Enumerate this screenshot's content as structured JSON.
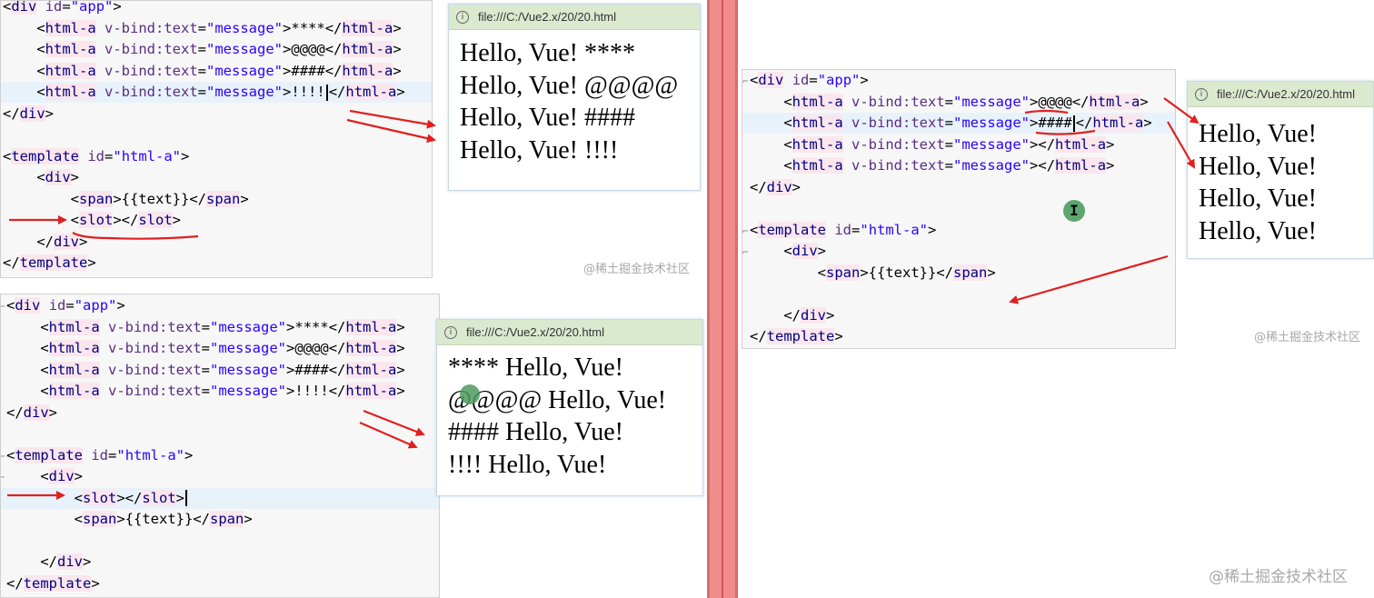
{
  "top_left": {
    "code": [
      {
        "kind": "open",
        "tag": "div",
        "attr": "id",
        "value": "app"
      },
      {
        "kind": "html-a",
        "content": "****"
      },
      {
        "kind": "html-a",
        "content": "@@@@"
      },
      {
        "kind": "html-a",
        "content": "####"
      },
      {
        "kind": "html-a",
        "content": "!!!!",
        "cursor": true
      },
      {
        "kind": "close",
        "tag": "div"
      },
      {
        "kind": "blank"
      },
      {
        "kind": "open",
        "tag": "template",
        "attr": "id",
        "value": "html-a"
      },
      {
        "kind": "open-plain",
        "tag": "div",
        "indent": 1
      },
      {
        "kind": "span",
        "indent": 2
      },
      {
        "kind": "slot",
        "indent": 2
      },
      {
        "kind": "close",
        "tag": "div",
        "indent": 1
      },
      {
        "kind": "close",
        "tag": "template"
      }
    ],
    "browser_url": "file:///C:/Vue2.x/20/20.html",
    "output": [
      "Hello, Vue! ****",
      "Hello, Vue! @@@@",
      "Hello, Vue! ####",
      "Hello, Vue! !!!!"
    ],
    "watermark": "@稀土掘金技术社区"
  },
  "bottom_left": {
    "code": [
      {
        "kind": "open",
        "tag": "div",
        "attr": "id",
        "value": "app"
      },
      {
        "kind": "html-a",
        "content": "****"
      },
      {
        "kind": "html-a",
        "content": "@@@@"
      },
      {
        "kind": "html-a",
        "content": "####"
      },
      {
        "kind": "html-a",
        "content": "!!!!"
      },
      {
        "kind": "close",
        "tag": "div"
      },
      {
        "kind": "blank"
      },
      {
        "kind": "open",
        "tag": "template",
        "attr": "id",
        "value": "html-a"
      },
      {
        "kind": "open-plain",
        "tag": "div",
        "indent": 1
      },
      {
        "kind": "slot",
        "indent": 2,
        "cursor": true
      },
      {
        "kind": "span",
        "indent": 2
      },
      {
        "kind": "blank"
      },
      {
        "kind": "close",
        "tag": "div",
        "indent": 1
      },
      {
        "kind": "close",
        "tag": "template"
      }
    ],
    "browser_url": "file:///C:/Vue2.x/20/20.html",
    "output": [
      "**** Hello, Vue!",
      "@@@@ Hello, Vue!",
      "#### Hello, Vue!",
      "!!!! Hello, Vue!"
    ]
  },
  "right": {
    "code": [
      {
        "kind": "open",
        "tag": "div",
        "attr": "id",
        "value": "app"
      },
      {
        "kind": "html-a",
        "content": "@@@@"
      },
      {
        "kind": "html-a",
        "content": "####",
        "cursor": true
      },
      {
        "kind": "html-a",
        "content": ""
      },
      {
        "kind": "html-a",
        "content": ""
      },
      {
        "kind": "close",
        "tag": "div"
      },
      {
        "kind": "blank"
      },
      {
        "kind": "open",
        "tag": "template",
        "attr": "id",
        "value": "html-a"
      },
      {
        "kind": "open-plain",
        "tag": "div",
        "indent": 1
      },
      {
        "kind": "span",
        "indent": 2
      },
      {
        "kind": "blank"
      },
      {
        "kind": "close",
        "tag": "div",
        "indent": 1
      },
      {
        "kind": "close",
        "tag": "template"
      }
    ],
    "browser_url": "file:///C:/Vue2.x/20/20.html",
    "output": [
      "Hello, Vue!",
      "Hello, Vue!",
      "Hello, Vue!",
      "Hello, Vue!"
    ],
    "watermark_panel": "@稀土掘金技术社区",
    "watermark_page": "@稀土掘金技术社区"
  },
  "syntax": {
    "component_tag": "html-a",
    "bind_attr": "v-bind:text",
    "bind_value": "message",
    "text_expr": "{{text}}"
  },
  "colors": {
    "divider": "#ef8d8d",
    "arrow": "#e02020",
    "browser_bar": "#dbe9cf",
    "marker_dot": "#4d9a5f"
  },
  "icons": {
    "text_cursor": "I"
  }
}
